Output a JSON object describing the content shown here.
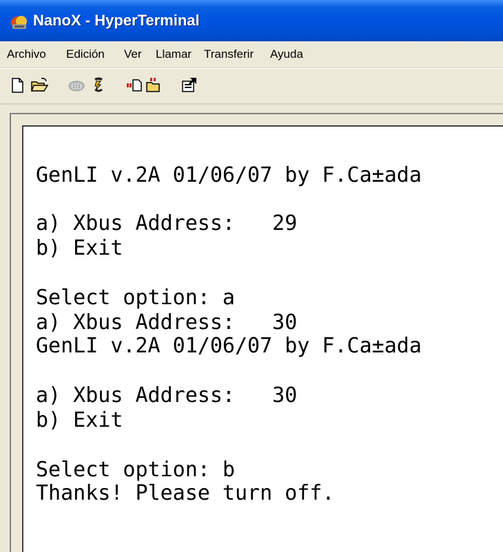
{
  "window": {
    "title": "NanoX - HyperTerminal"
  },
  "menu": {
    "items": [
      "Archivo",
      "Edición",
      "Ver",
      "Llamar",
      "Transferir",
      "Ayuda"
    ]
  },
  "toolbar": {
    "buttons": [
      {
        "icon": "new-document-icon"
      },
      {
        "icon": "open-folder-icon"
      },
      {
        "icon": "phone-icon"
      },
      {
        "icon": "disconnect-icon"
      },
      {
        "icon": "send-icon"
      },
      {
        "icon": "receive-icon"
      },
      {
        "icon": "properties-icon"
      }
    ]
  },
  "terminal": {
    "lines": [
      "GenLI v.2A 01/06/07 by F.Ca±ada",
      "a) Xbus Address:   29",
      "b) Exit",
      "Select option: a",
      "a) Xbus Address:   30",
      "GenLI v.2A 01/06/07 by F.Ca±ada",
      "a) Xbus Address:   30",
      "b) Exit",
      "Select option: b",
      "Thanks! Please turn off."
    ]
  },
  "colors": {
    "titlebar": "#0054e3",
    "window_bg": "#ece9d8",
    "terminal_bg": "#ffffff",
    "terminal_text": "#000000"
  }
}
